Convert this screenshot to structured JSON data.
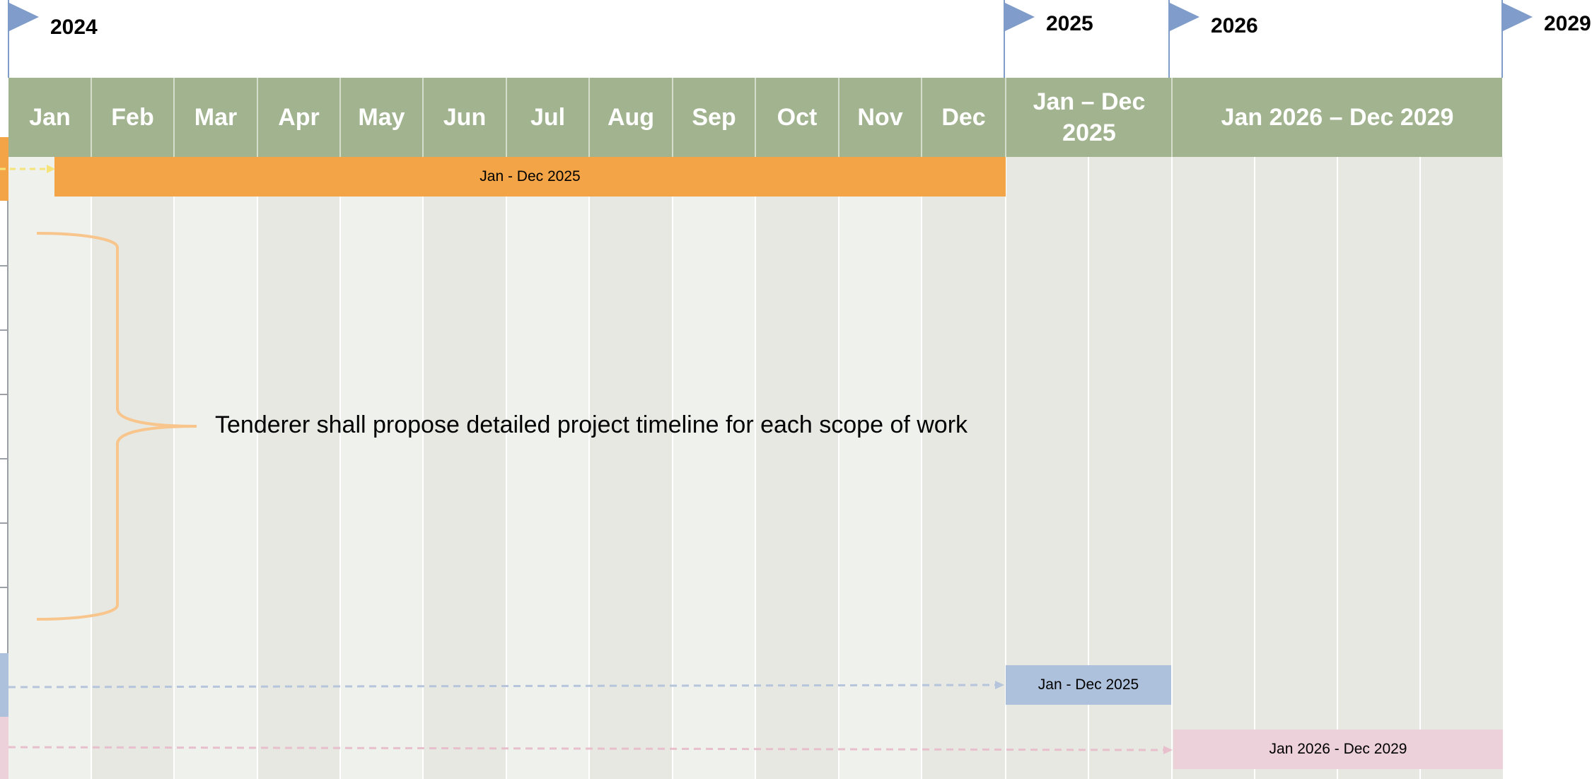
{
  "milestones": [
    {
      "label": "2024"
    },
    {
      "label": "2025"
    },
    {
      "label": "2026"
    },
    {
      "label": "2029"
    }
  ],
  "header": {
    "months": [
      "Jan",
      "Feb",
      "Mar",
      "Apr",
      "May",
      "Jun",
      "Jul",
      "Aug",
      "Sep",
      "Oct",
      "Nov",
      "Dec"
    ],
    "period_2025": "Jan – Dec 2025",
    "period_2026_2029": "Jan 2026 – Dec 2029"
  },
  "tasks": [
    {
      "label": "Jan - Dec 2025",
      "color": "#f2a446"
    },
    {
      "label": "Jan - Dec 2025",
      "color": "#adc1dc"
    },
    {
      "label": "Jan 2026 - Dec 2029",
      "color": "#ecd0da"
    }
  ],
  "annotation": {
    "text": "Tenderer shall propose detailed project timeline for each scope of work",
    "brace_color": "#f8c58d"
  },
  "colors": {
    "header_green": "#a2b38f",
    "flag_blue": "#7f9ccb"
  }
}
